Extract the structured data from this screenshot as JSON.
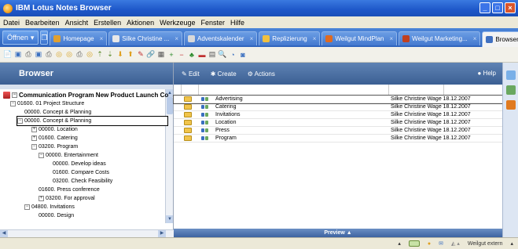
{
  "window": {
    "title": "IBM Lotus Notes Browser"
  },
  "menu": [
    "Datei",
    "Bearbeiten",
    "Ansicht",
    "Erstellen",
    "Aktionen",
    "Werkzeuge",
    "Fenster",
    "Hilfe"
  ],
  "tabbar": {
    "open_label": "Öffnen",
    "tabs": [
      {
        "label": "Homepage",
        "icon": "home-icon",
        "color": "#e0a030"
      },
      {
        "label": "Silke Christine ...",
        "icon": "mail-icon",
        "color": "#e8e8e8"
      },
      {
        "label": "Adventskalender",
        "icon": "calendar-icon",
        "color": "#d9d9d9"
      },
      {
        "label": "Replizierung",
        "icon": "replicate-icon",
        "color": "#f0c040"
      },
      {
        "label": "Weilgut MindPlan",
        "icon": "mindplan-icon",
        "color": "#e06a20"
      },
      {
        "label": "Weilgut Marketing...",
        "icon": "marketing-icon",
        "color": "#c04020"
      },
      {
        "label": "Browser",
        "icon": "browser-icon",
        "color": "#4070c0",
        "active": true
      }
    ]
  },
  "left_panel": {
    "header": "Browser",
    "tree": [
      {
        "label": "Communication Program New Product Launch Co",
        "indent": 0,
        "type": "root"
      },
      {
        "label": "01600. 01 Project Structure",
        "indent": 1,
        "type": "expanded"
      },
      {
        "label": "00000. Concept & Planning",
        "indent": 3,
        "type": "leaf"
      },
      {
        "label": "00000. Concept & Planning",
        "indent": 2,
        "type": "expanded",
        "selected": true
      },
      {
        "label": "00000. Location",
        "indent": 4,
        "type": "collapsed"
      },
      {
        "label": "01600. Catering",
        "indent": 4,
        "type": "collapsed"
      },
      {
        "label": "03200. Program",
        "indent": 4,
        "type": "expanded"
      },
      {
        "label": "00000. Entertainment",
        "indent": 5,
        "type": "expanded"
      },
      {
        "label": "00000. Develop ideas",
        "indent": 7,
        "type": "leaf"
      },
      {
        "label": "01600. Compare Costs",
        "indent": 7,
        "type": "leaf"
      },
      {
        "label": "03200. Check Feasibility",
        "indent": 7,
        "type": "leaf"
      },
      {
        "label": "01600. Press conference",
        "indent": 5,
        "type": "leaf"
      },
      {
        "label": "03200. For approval",
        "indent": 5,
        "type": "collapsed"
      },
      {
        "label": "04800. Invitations",
        "indent": 3,
        "type": "expanded"
      },
      {
        "label": "00000. Design",
        "indent": 5,
        "type": "leaf"
      }
    ]
  },
  "right_panel": {
    "actions": {
      "edit": "Edit",
      "create": "Create",
      "actions": "Actions",
      "help": "Help"
    },
    "rows": [
      {
        "name": "Advertising",
        "author": "Silke Christine Wage 18.12.2007"
      },
      {
        "name": "Catering",
        "author": "Silke Christine Wage 18.12.2007"
      },
      {
        "name": "Invitations",
        "author": "Silke Christine Wage 18.12.2007"
      },
      {
        "name": "Location",
        "author": "Silke Christine Wage 18.12.2007"
      },
      {
        "name": "Press",
        "author": "Silke Christine Wage 18.12.2007"
      },
      {
        "name": "Program",
        "author": "Silke Christine Wage 18.12.2007"
      }
    ],
    "preview_label": "Preview ▲"
  },
  "statusbar": {
    "location": "Weilgut extern"
  }
}
